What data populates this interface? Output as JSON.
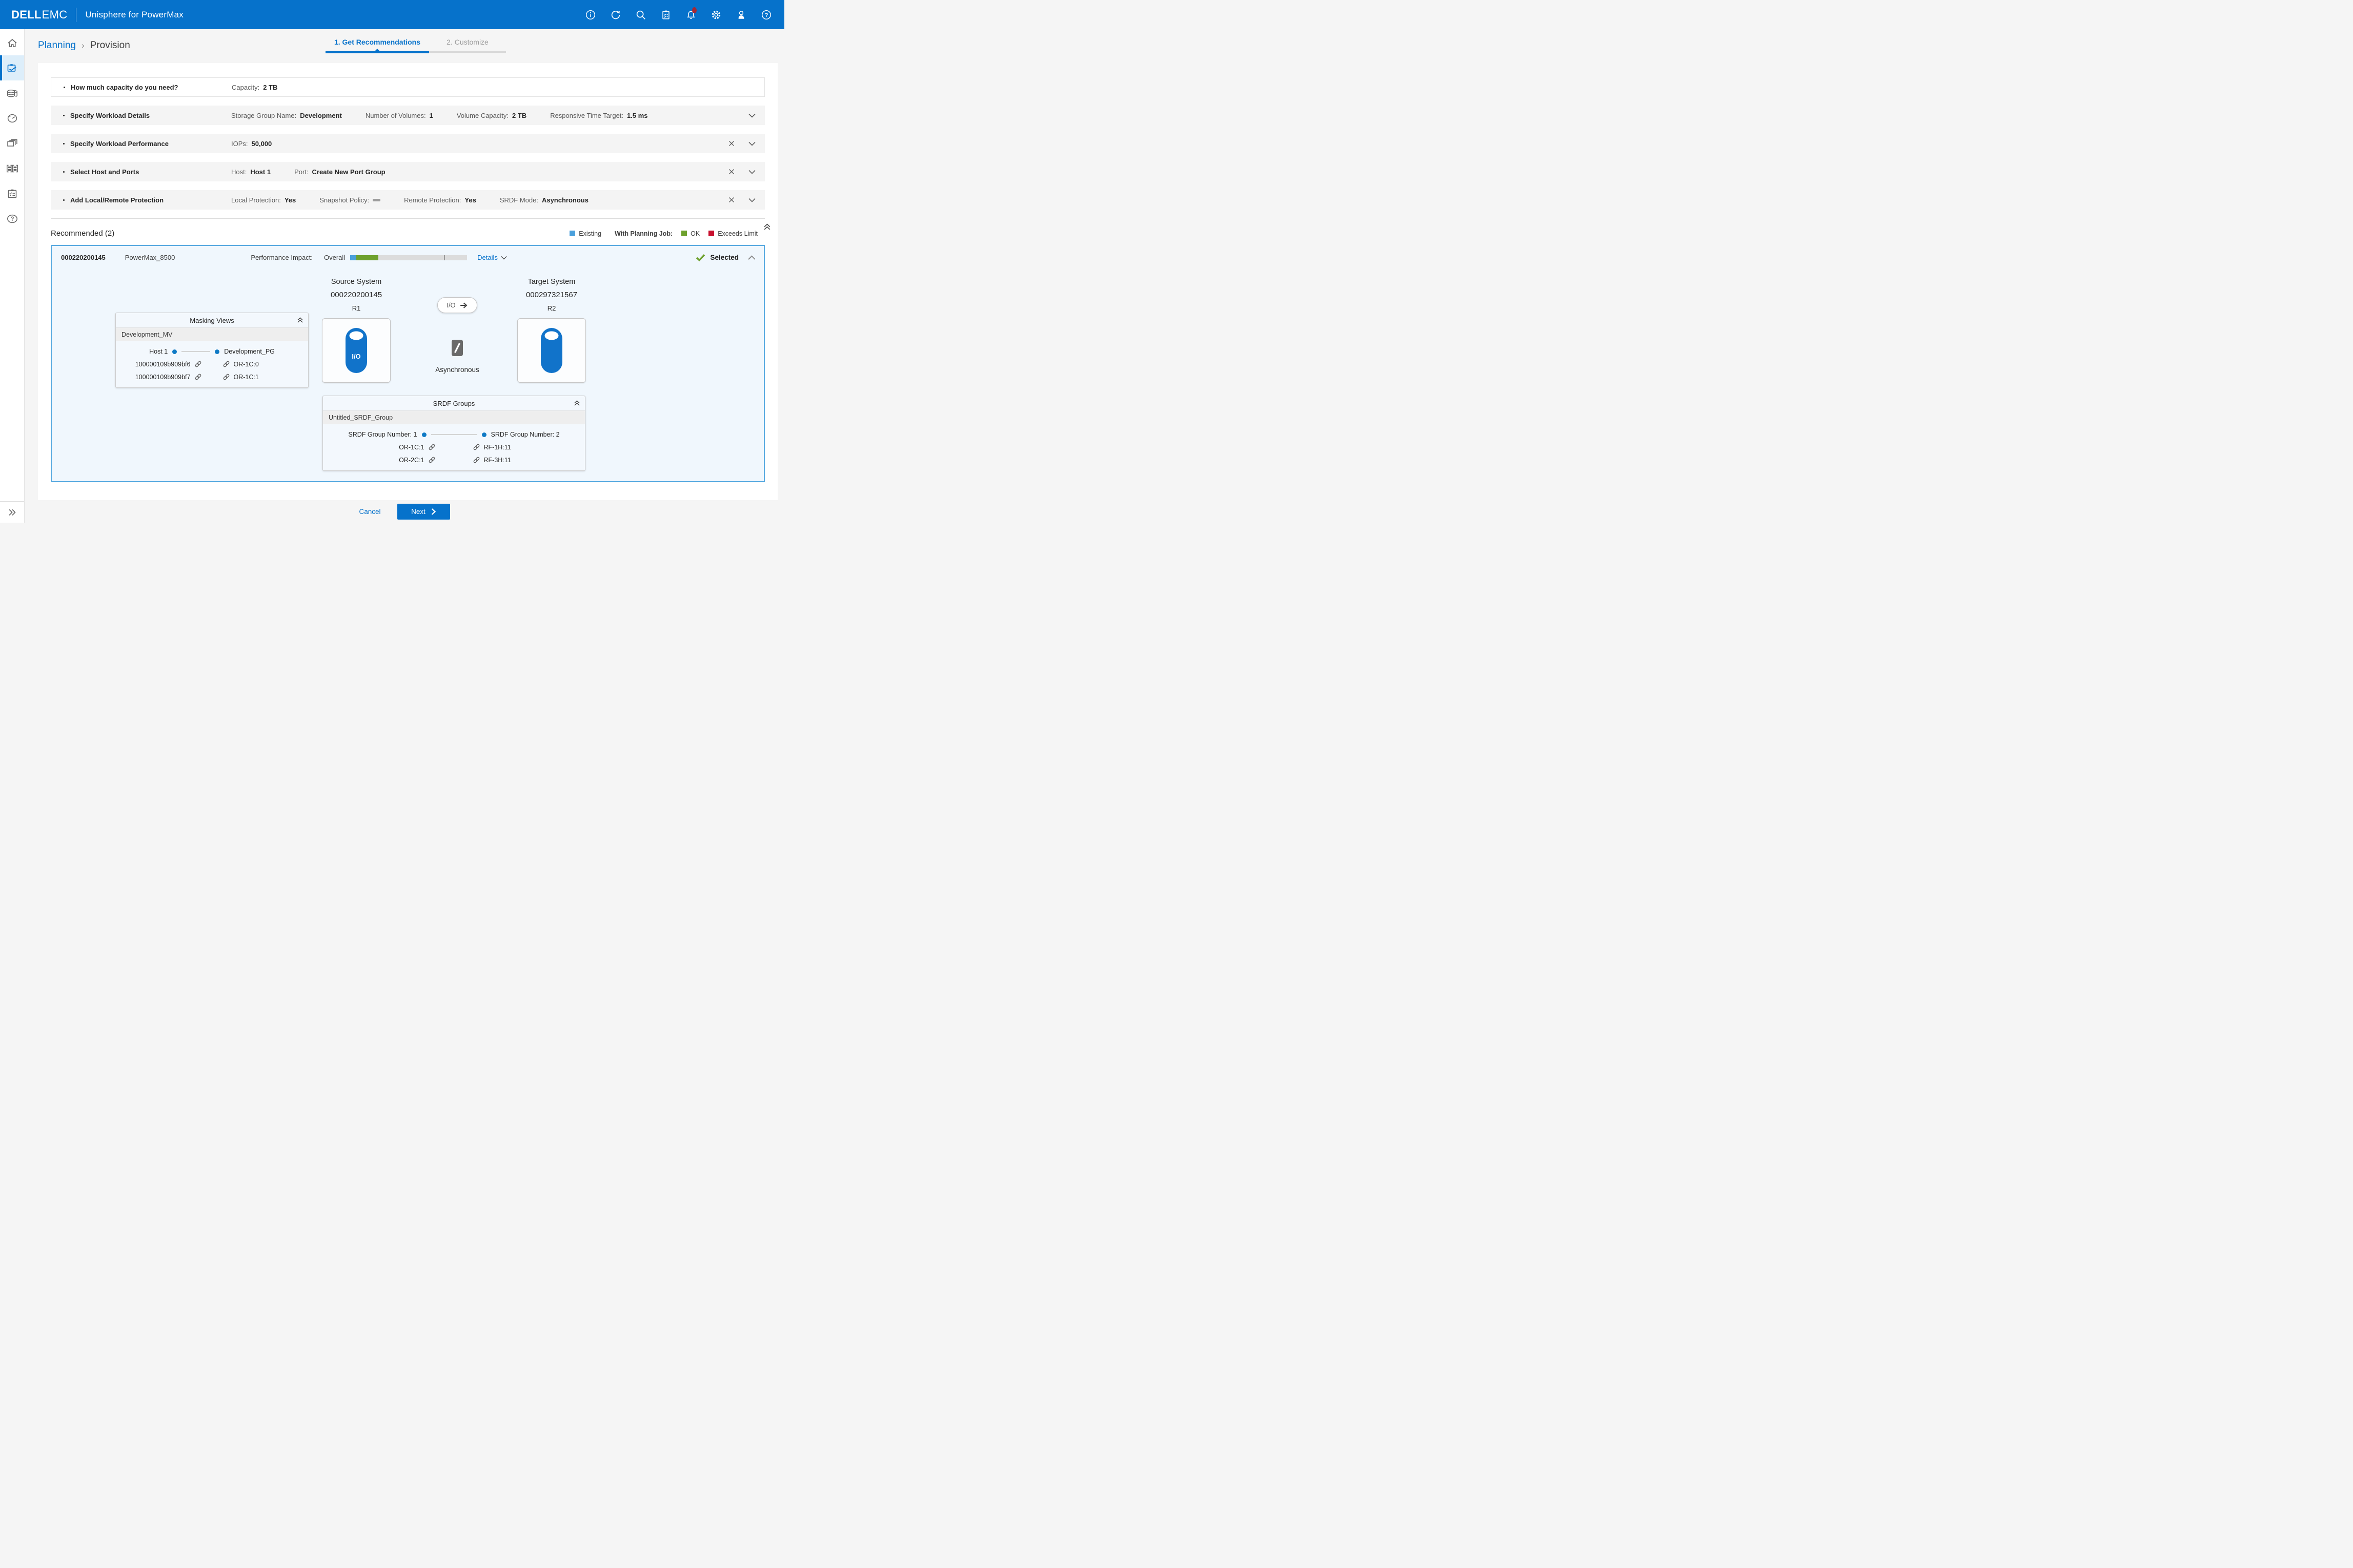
{
  "header": {
    "brand": {
      "dell": "DELL",
      "emc": "EMC"
    },
    "title": "Unisphere for PowerMax",
    "icons": [
      "info",
      "refresh",
      "search",
      "job-list",
      "alerts",
      "settings",
      "user",
      "help"
    ],
    "alerts_badge_visible": true
  },
  "sidebar": {
    "items": [
      "home",
      "planning",
      "storage",
      "performance",
      "replication",
      "system",
      "jobs",
      "support"
    ],
    "active_item": "planning"
  },
  "breadcrumb": {
    "parent": "Planning",
    "separator": "›",
    "current": "Provision"
  },
  "tabs": [
    {
      "label": "1. Get Recommendations",
      "active": true
    },
    {
      "label": "2. Customize",
      "active": false
    }
  ],
  "steps": [
    {
      "title": "How much capacity do you need?",
      "fields": [
        {
          "label": "Capacity:",
          "value": "2 TB"
        }
      ]
    },
    {
      "title": "Specify Workload Details",
      "fields": [
        {
          "label": "Storage Group Name:",
          "value": "Development"
        },
        {
          "label": "Number of Volumes:",
          "value": "1"
        },
        {
          "label": "Volume Capacity:",
          "value": "2 TB"
        },
        {
          "label": "Responsive Time Target:",
          "value": "1.5 ms"
        }
      ]
    },
    {
      "title": "Specify Workload Performance",
      "fields": [
        {
          "label": "IOPs:",
          "value": "50,000"
        }
      ]
    },
    {
      "title": "Select Host and Ports",
      "fields": [
        {
          "label": "Host:",
          "value": "Host 1"
        },
        {
          "label": "Port:",
          "value": "Create New Port Group"
        }
      ]
    },
    {
      "title": "Add Local/Remote Protection",
      "fields": [
        {
          "label": "Local Protection:",
          "value": "Yes"
        },
        {
          "label": "Snapshot Policy:",
          "value": ""
        },
        {
          "label": "Remote Protection:",
          "value": "Yes"
        },
        {
          "label": "SRDF Mode:",
          "value": "Asynchronous"
        }
      ]
    }
  ],
  "recommended": {
    "heading": "Recommended (2)",
    "legend": {
      "existing_label": "Existing",
      "planning_caption": "With Planning Job:",
      "ok_label": "OK",
      "exceeds_label": "Exceeds Limit"
    },
    "card": {
      "system_id": "000220200145",
      "model": "PowerMax_8500",
      "impact_label": "Performance Impact:",
      "overall_label": "Overall",
      "performance_bar": {
        "existing_pct": 5,
        "planned_pct": 19,
        "limit_marker_pct": 80
      },
      "details_label": "Details",
      "selected_label": "Selected",
      "source": {
        "title": "Source System",
        "id": "000220200145",
        "role": "R1",
        "volume_label": "I/O"
      },
      "io_button_label": "I/O",
      "replication_mode": "Asynchronous",
      "target": {
        "title": "Target System",
        "id": "000297321567",
        "role": "R2"
      },
      "masking_views": {
        "title": "Masking Views",
        "group_name": "Development_MV",
        "left_node": "Host 1",
        "right_node": "Development_PG",
        "links": [
          {
            "left": "100000109b909bf6",
            "right": "OR-1C:0"
          },
          {
            "left": "100000109b909bf7",
            "right": "OR-1C:1"
          }
        ]
      },
      "srdf_groups": {
        "title": "SRDF Groups",
        "group_name": "Untitled_SRDF_Group",
        "left_node": "SRDF Group Number: 1",
        "right_node": "SRDF Group Number: 2",
        "links": [
          {
            "left": "OR-1C:1",
            "right": "RF-1H:11"
          },
          {
            "left": "OR-2C:1",
            "right": "RF-3H:11"
          }
        ]
      }
    }
  },
  "footer": {
    "cancel_label": "Cancel",
    "next_label": "Next"
  },
  "colors": {
    "brand_blue": "#0672CB",
    "legend_existing": "#4AA0DC",
    "status_ok": "#6EA12D",
    "status_exceeds": "#C8102E",
    "card_border": "#57A9E0"
  }
}
